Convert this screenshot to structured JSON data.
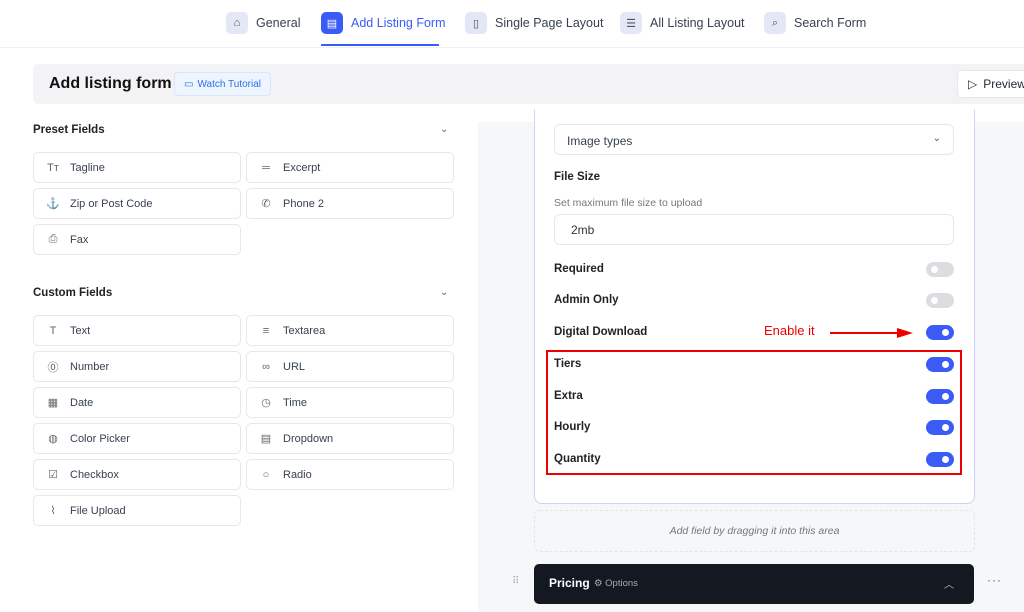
{
  "tabs": [
    {
      "label": "General",
      "icon": "home-icon"
    },
    {
      "label": "Add Listing Form",
      "icon": "form-icon",
      "active": true
    },
    {
      "label": "Single Page Layout",
      "icon": "page-icon"
    },
    {
      "label": "All Listing Layout",
      "icon": "list-icon"
    },
    {
      "label": "Search Form",
      "icon": "search-icon"
    }
  ],
  "header": {
    "title": "Add listing form",
    "watch": "Watch Tutorial",
    "preview": "Preview"
  },
  "preset": {
    "title": "Preset Fields",
    "items": [
      {
        "label": "Tagline",
        "icon": "text-size-icon"
      },
      {
        "label": "Excerpt",
        "icon": "excerpt-icon"
      },
      {
        "label": "Zip or Post Code",
        "icon": "anchor-icon"
      },
      {
        "label": "Phone 2",
        "icon": "phone-icon"
      },
      {
        "label": "Fax",
        "icon": "fax-icon"
      }
    ]
  },
  "custom": {
    "title": "Custom Fields",
    "items": [
      {
        "label": "Text",
        "icon": "text-icon"
      },
      {
        "label": "Textarea",
        "icon": "textarea-icon"
      },
      {
        "label": "Number",
        "icon": "number-icon"
      },
      {
        "label": "URL",
        "icon": "link-icon"
      },
      {
        "label": "Date",
        "icon": "calendar-icon"
      },
      {
        "label": "Time",
        "icon": "clock-icon"
      },
      {
        "label": "Color Picker",
        "icon": "palette-icon"
      },
      {
        "label": "Dropdown",
        "icon": "dropdown-icon"
      },
      {
        "label": "Checkbox",
        "icon": "checkbox-icon"
      },
      {
        "label": "Radio",
        "icon": "radio-icon"
      },
      {
        "label": "File Upload",
        "icon": "paperclip-icon"
      }
    ]
  },
  "settings": {
    "select_value": "Image types",
    "file_size_label": "File Size",
    "file_size_hint": "Set maximum file size to upload",
    "file_size_value": "2mb",
    "toggles": [
      {
        "label": "Required",
        "on": false
      },
      {
        "label": "Admin Only",
        "on": false
      },
      {
        "label": "Digital Download",
        "on": true
      },
      {
        "label": "Tiers",
        "on": true
      },
      {
        "label": "Extra",
        "on": true
      },
      {
        "label": "Hourly",
        "on": true
      },
      {
        "label": "Quantity",
        "on": true
      }
    ]
  },
  "annotation": "Enable it",
  "dropzone": "Add field by dragging it into this area",
  "pricing": {
    "title": "Pricing",
    "options": "Options"
  },
  "colors": {
    "accent": "#3b5bf6",
    "annotation": "#ee0000"
  }
}
